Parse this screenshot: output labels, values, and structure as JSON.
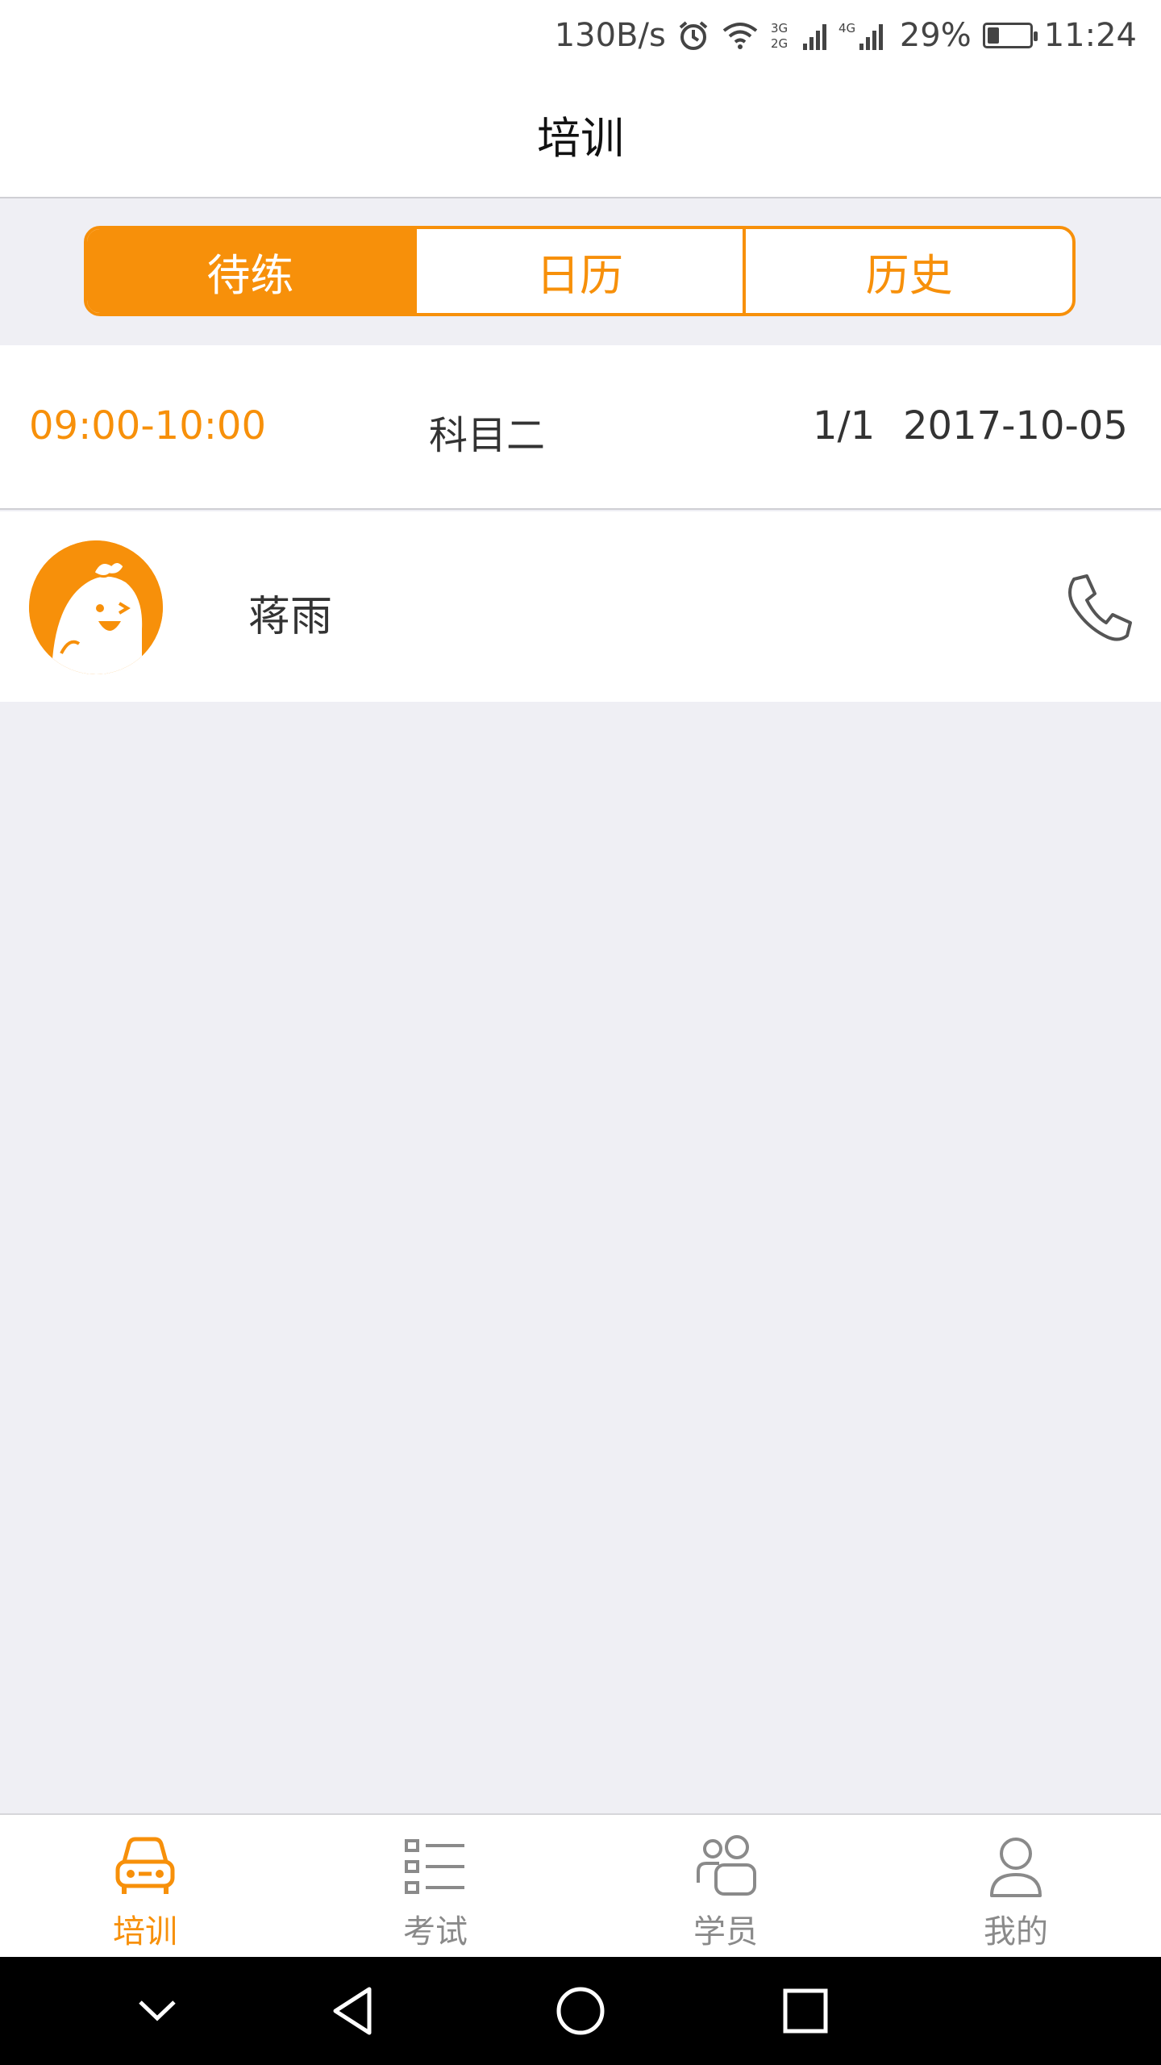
{
  "status_bar": {
    "net_speed": "130B/s",
    "net_3g": "3G",
    "net_2g": "2G",
    "net_4g": "4G",
    "battery_percent": "29%",
    "battery_level": 0.29,
    "time": "11:24"
  },
  "header": {
    "title": "培训"
  },
  "segments": {
    "items": [
      {
        "label": "待练",
        "active": true
      },
      {
        "label": "日历",
        "active": false
      },
      {
        "label": "历史",
        "active": false
      }
    ]
  },
  "session": {
    "time": "09:00-10:00",
    "subject": "科目二",
    "count": "1/1",
    "date": "2017-10-05"
  },
  "student": {
    "name": "蒋雨",
    "avatar_icon": "mascot-avatar-icon",
    "action_icon": "phone-icon"
  },
  "tabbar": {
    "items": [
      {
        "label": "培训",
        "icon": "car-icon",
        "active": true
      },
      {
        "label": "考试",
        "icon": "list-icon",
        "active": false
      },
      {
        "label": "学员",
        "icon": "users-icon",
        "active": false
      },
      {
        "label": "我的",
        "icon": "person-icon",
        "active": false
      }
    ]
  },
  "nav_bar": {
    "buttons": [
      "chevron-down-icon",
      "back-icon",
      "home-icon",
      "recents-icon"
    ]
  },
  "colors": {
    "accent": "#f7900a",
    "background": "#efeff4",
    "text": "#333333",
    "inactive": "#8a8a8a"
  }
}
